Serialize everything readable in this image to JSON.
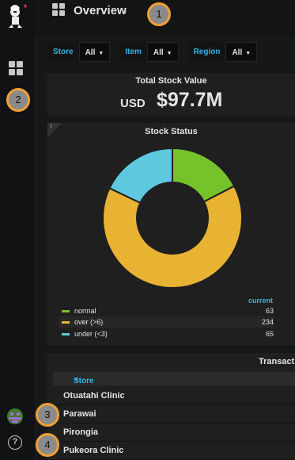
{
  "sidebar": {
    "logo_icon": "grafana-chef-logo-icon",
    "dashboards_icon": "dashboards-grid-icon",
    "user_avatar": "user-avatar",
    "help_icon_text": "?"
  },
  "markers": [
    "1",
    "2",
    "3",
    "4"
  ],
  "topbar": {
    "dashboard_icon": "dashboard-grid-icon",
    "title": "Overview",
    "caret": "▾"
  },
  "variables": [
    {
      "label": "Store",
      "value": "All"
    },
    {
      "label": "Item",
      "value": "All"
    },
    {
      "label": "Region",
      "value": "All"
    }
  ],
  "stat_panel": {
    "title": "Total Stock Value",
    "prefix": "USD",
    "value": "$97.7M"
  },
  "pie_panel": {
    "info": "i",
    "title": "Stock Status",
    "legend_header": "current",
    "colors": {
      "normal": "#7eb26d",
      "over": "#e5ac0e",
      "under": "#64b0c8"
    }
  },
  "chart_data": {
    "type": "pie",
    "title": "Stock Status",
    "donut": true,
    "slices": [
      {
        "name": "normal",
        "value": 63,
        "color": "#76c22a"
      },
      {
        "name": "over (>6)",
        "value": 234,
        "color": "#e8b233"
      },
      {
        "name": "under (<3)",
        "value": 65,
        "color": "#5ec8df"
      }
    ],
    "legend_column": "current"
  },
  "table_panel": {
    "title": "Transactio",
    "column": "Store",
    "sort_icon": "sort-ascending-icon",
    "rows": [
      "Otuatahi Clinic",
      "Parawai",
      "Pirongia",
      "Pukeora Clinic"
    ]
  }
}
